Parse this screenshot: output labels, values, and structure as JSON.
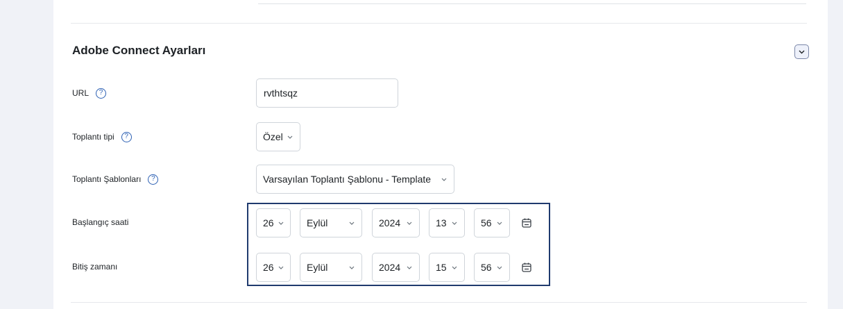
{
  "section": {
    "title": "Adobe Connect Ayarları"
  },
  "fields": {
    "url": {
      "label": "URL",
      "value": "rvthtsqz"
    },
    "meeting_type": {
      "label": "Toplantı tipi",
      "value": "Özel"
    },
    "meeting_templates": {
      "label": "Toplantı Şablonları",
      "value": "Varsayılan Toplantı Şablonu - Template"
    },
    "start_time": {
      "label": "Başlangıç saati",
      "day": "26",
      "month": "Eylül",
      "year": "2024",
      "hour": "13",
      "minute": "56"
    },
    "end_time": {
      "label": "Bitiş zamanı",
      "day": "26",
      "month": "Eylül",
      "year": "2024",
      "hour": "15",
      "minute": "56"
    }
  },
  "icons": {
    "help": "question-circle-icon",
    "calendar": "calendar-icon",
    "chevron": "chevron-down-icon"
  },
  "colors": {
    "background": "#f0f2f7",
    "highlight_border": "#1f3a6e",
    "help_icon": "#2b5fb3"
  }
}
